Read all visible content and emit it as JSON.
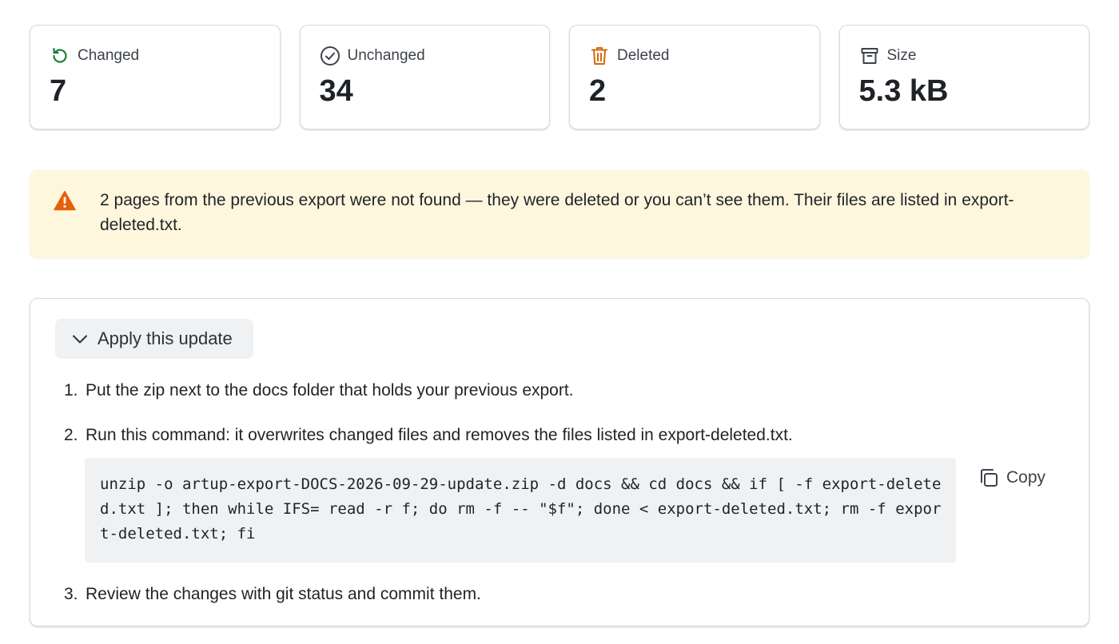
{
  "stats": [
    {
      "label": "Changed",
      "value": "7",
      "icon": "refresh-icon",
      "color": "#1a7f37"
    },
    {
      "label": "Unchanged",
      "value": "34",
      "icon": "check-circle-icon",
      "color": "#3d434a"
    },
    {
      "label": "Deleted",
      "value": "2",
      "icon": "trash-icon",
      "color": "#d4680b"
    },
    {
      "label": "Size",
      "value": "5.3 kB",
      "icon": "archive-icon",
      "color": "#3d434a"
    }
  ],
  "warning": {
    "icon": "warning-icon",
    "color": "#e36209",
    "text": "2 pages from the previous export were not found — they were deleted or you can’t see them. Their files are listed in export-deleted.txt."
  },
  "update": {
    "toggle_label": "Apply this update",
    "steps": [
      {
        "num": "1.",
        "text": "Put the zip next to the docs folder that holds your previous export."
      },
      {
        "num": "2.",
        "text": "Run this command: it overwrites changed files and removes the files listed in export-deleted.txt."
      },
      {
        "num": "3.",
        "text": "Review the changes with git status and commit them."
      }
    ],
    "command": "unzip -o artup-export-DOCS-2026-09-29-update.zip -d docs && cd docs && if [ -f export-deleted.txt ]; then while IFS= read -r f; do rm -f -- \"$f\"; done < export-deleted.txt; rm -f export-deleted.txt; fi",
    "copy_label": "Copy"
  }
}
